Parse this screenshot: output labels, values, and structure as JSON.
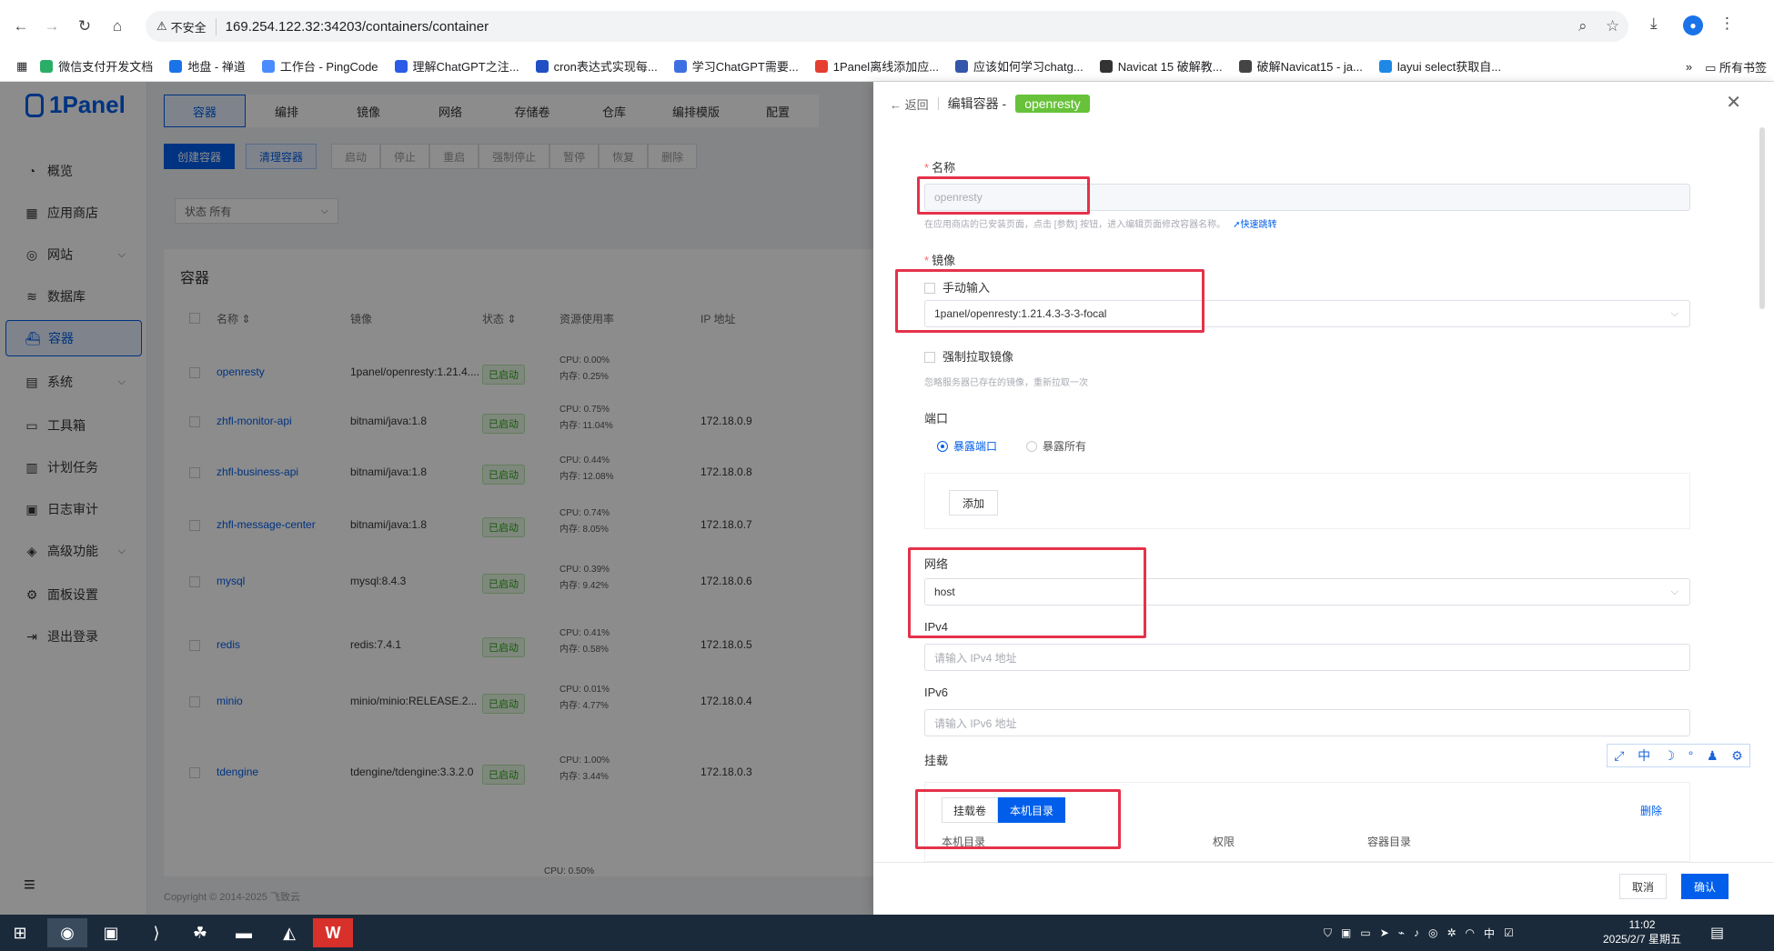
{
  "browser": {
    "insecure_label": "不安全",
    "url": "169.254.122.32:34203/containers/container",
    "bookmarks": [
      {
        "label": "微信支付开发文档",
        "color": "#2aae67"
      },
      {
        "label": "地盘 - 禅道",
        "color": "#1a73e8"
      },
      {
        "label": "工作台 - PingCode",
        "color": "#4a8cff"
      },
      {
        "label": "理解ChatGPT之注...",
        "color": "#2b5ce6"
      },
      {
        "label": "cron表达式实现每...",
        "color": "#1f4fc3"
      },
      {
        "label": "学习ChatGPT需要...",
        "color": "#3d6fe0"
      },
      {
        "label": "1Panel离线添加应...",
        "color": "#e53d2f"
      },
      {
        "label": "应该如何学习chatg...",
        "color": "#3355aa"
      },
      {
        "label": "Navicat 15 破解教...",
        "color": "#333333"
      },
      {
        "label": "破解Navicat15 - ja...",
        "color": "#444444"
      },
      {
        "label": "layui select获取自...",
        "color": "#1e88e5"
      }
    ],
    "all_bookmarks": "所有书签",
    "more": "»"
  },
  "sidebar": {
    "logo": "1Panel",
    "items": [
      {
        "label": "概览",
        "icon": "◔"
      },
      {
        "label": "应用商店",
        "icon": "▦"
      },
      {
        "label": "网站",
        "icon": "◎"
      },
      {
        "label": "数据库",
        "icon": "≋"
      },
      {
        "label": "容器",
        "icon": "⛴"
      },
      {
        "label": "系统",
        "icon": "▤"
      },
      {
        "label": "工具箱",
        "icon": "▭"
      },
      {
        "label": "计划任务",
        "icon": "▥"
      },
      {
        "label": "日志审计",
        "icon": "▣"
      },
      {
        "label": "高级功能",
        "icon": "◈"
      },
      {
        "label": "面板设置",
        "icon": "⚙"
      },
      {
        "label": "退出登录",
        "icon": "⇥"
      }
    ]
  },
  "main": {
    "tabs": [
      "容器",
      "编排",
      "镜像",
      "网络",
      "存储卷",
      "仓库",
      "编排模版",
      "配置"
    ],
    "toolbar": [
      "创建容器",
      "清理容器",
      "启动",
      "停止",
      "重启",
      "强制停止",
      "暂停",
      "恢复",
      "删除"
    ],
    "status_filter": "状态  所有",
    "card_title": "容器",
    "columns": [
      "名称 ⇕",
      "镜像",
      "状态 ⇕",
      "资源使用率",
      "IP 地址"
    ],
    "rows": [
      {
        "name": "openresty",
        "image": "1panel/openresty:1.21.4....",
        "status": "已启动",
        "cpu": "CPU: 0.00%",
        "mem": "内存: 0.25%",
        "ip": ""
      },
      {
        "name": "zhfl-monitor-api",
        "image": "bitnami/java:1.8",
        "status": "已启动",
        "cpu": "CPU: 0.75%",
        "mem": "内存: 11.04%",
        "ip": "172.18.0.9"
      },
      {
        "name": "zhfl-business-api",
        "image": "bitnami/java:1.8",
        "status": "已启动",
        "cpu": "CPU: 0.44%",
        "mem": "内存: 12.08%",
        "ip": "172.18.0.8"
      },
      {
        "name": "zhfl-message-center",
        "image": "bitnami/java:1.8",
        "status": "已启动",
        "cpu": "CPU: 0.74%",
        "mem": "内存: 8.05%",
        "ip": "172.18.0.7"
      },
      {
        "name": "mysql",
        "image": "mysql:8.4.3",
        "status": "已启动",
        "cpu": "CPU: 0.39%",
        "mem": "内存: 9.42%",
        "ip": "172.18.0.6"
      },
      {
        "name": "redis",
        "image": "redis:7.4.1",
        "status": "已启动",
        "cpu": "CPU: 0.41%",
        "mem": "内存: 0.58%",
        "ip": "172.18.0.5"
      },
      {
        "name": "minio",
        "image": "minio/minio:RELEASE.2...",
        "status": "已启动",
        "cpu": "CPU: 0.01%",
        "mem": "内存: 4.77%",
        "ip": "172.18.0.4"
      },
      {
        "name": "tdengine",
        "image": "tdengine/tdengine:3.3.2.0",
        "status": "已启动",
        "cpu": "CPU: 1.00%",
        "mem": "内存: 3.44%",
        "ip": "172.18.0.3"
      }
    ],
    "trailing_cpu": "CPU: 0.50%",
    "footer": "Copyright © 2014-2025 飞致云"
  },
  "drawer": {
    "back": "返回",
    "title": "编辑容器 -",
    "container_name": "openresty",
    "name_label": "名称",
    "name_value": "openresty",
    "name_hint": "在应用商店的已安装页面，点击 [参数] 按钮，进入编辑页面修改容器名称。",
    "quick_jump": "快速跳转",
    "image_label": "镜像",
    "manual_input": "手动输入",
    "image_value": "1panel/openresty:1.21.4.3-3-3-focal",
    "force_pull": "强制拉取镜像",
    "force_pull_hint": "忽略服务器已存在的镜像，重新拉取一次",
    "port_label": "端口",
    "expose_port": "暴露端口",
    "expose_all": "暴露所有",
    "add": "添加",
    "network_label": "网络",
    "network_value": "host",
    "ipv4_label": "IPv4",
    "ipv4_placeholder": "请输入 IPv4 地址",
    "ipv6_label": "IPv6",
    "ipv6_placeholder": "请输入 IPv6 地址",
    "mount_label": "挂载",
    "mount_volume": "挂载卷",
    "mount_host_dir": "本机目录",
    "mount_delete": "删除",
    "mount_cols": [
      "本机目录",
      "权限",
      "容器目录"
    ],
    "cancel": "取消",
    "confirm": "确认"
  },
  "ime": [
    "⤢",
    "中",
    "☽",
    "°",
    "♟",
    "⚙"
  ],
  "taskbar": {
    "apps": [
      "⊞",
      "◉",
      "▣",
      "⟩",
      "☘",
      "▬",
      "◭",
      "W"
    ],
    "tray_lang": "中",
    "time": "11:02",
    "date": "2025/2/7 星期五"
  },
  "colors": {
    "accent": "#005eeb",
    "success": "#67c23a",
    "highlight": "#e5324a"
  }
}
